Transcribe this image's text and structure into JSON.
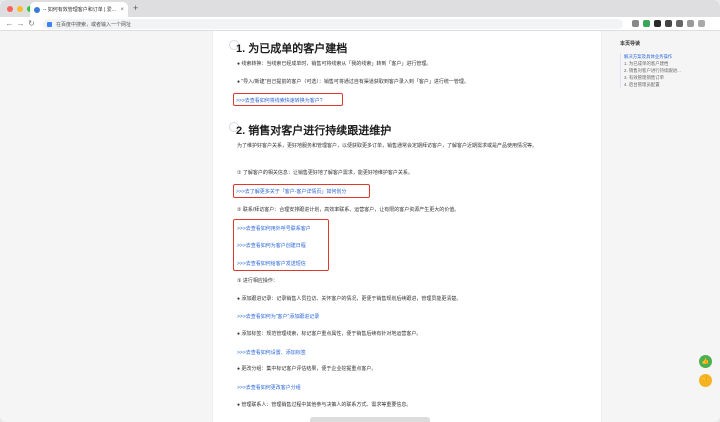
{
  "browser": {
    "tab_title": "-- 如何有效管理客户和订单 | 爱...",
    "close": "×",
    "new_tab": "+",
    "back": "←",
    "forward": "→",
    "reload": "↻",
    "address_placeholder": "在百度中搜索，或者输入一个网址",
    "colors": {
      "red": "#ff5f57",
      "yellow": "#febc2e",
      "green": "#28c840"
    }
  },
  "article": {
    "section1": {
      "title": "1. 为已成单的客户建档",
      "bullet1": "● 线索转换：当线索已经成单时，销售可将线索从「我的线索」转到「客户」进行管理。",
      "bullet2": "● \"导入/新建\"自己提前的客户（可选）：销售可将通过自有渠道获取到客户录入到「客户」进行统一管理。",
      "link1": ">>>去查看如何将线索快速转换为客户?"
    },
    "section2": {
      "title": "2. 销售对客户进行持续跟进维护",
      "intro": "为了维护好客户关系，更好地服务和管理客户，以便获取更多订单，销售通常会定期拜访客户，了解客户近期需求或是产品使用情况等。",
      "step1": "① 了解客户的相关信息：让销售更好地了解客户需求，能更好地维护客户关系。",
      "link_detail": ">>>去了解更多关于「客户-客户详情页」如何划分",
      "step2": "② 联系/拜访客户：合理安排跟进计划，高效率联系、运营客户，让有限的客户资源产生更大的价值。",
      "link_contact1": ">>>去查看如何用外呼号联系客户",
      "link_contact2": ">>>去查看如何为客户创建日程",
      "link_contact3": ">>>去查看如何给客户发送短信",
      "step3": "③ 进行相应操作：",
      "op1": "● 添加跟进记录：记录销售人员拉访、关怀客户的情况，更便于销售规划后续跟进，管理员能更清楚。",
      "op1_link": ">>>去查看如何为\"客户\"添加跟进记录",
      "op2": "● 添加标签：规范管理线索，标记客户重点属性，便于销售后续有针对地运营客户。",
      "op2_link": ">>>去查看如何设置、添加标签",
      "op3": "● 更改分组：集中标记客户评估结果，便于企业挖掘重点客户。",
      "op3_link": ">>>去查看如何更改客户分组",
      "op4": "● 管理联系人：管理销售过程中其他参与决策人的联系方式、需求等重要信息。"
    }
  },
  "toc": {
    "title": "本页导读",
    "items": [
      "解决方案及具体业务操作",
      "1. 为已成单的客户建档",
      "2. 销售对客户进行持续跟进...",
      "3. 有效管理销售订单",
      "4. 后台管理员配置"
    ]
  },
  "float_buttons": {
    "like": "👍",
    "dislike": "👎",
    "like_color": "#4caf50",
    "dislike_color": "#f5b323"
  }
}
